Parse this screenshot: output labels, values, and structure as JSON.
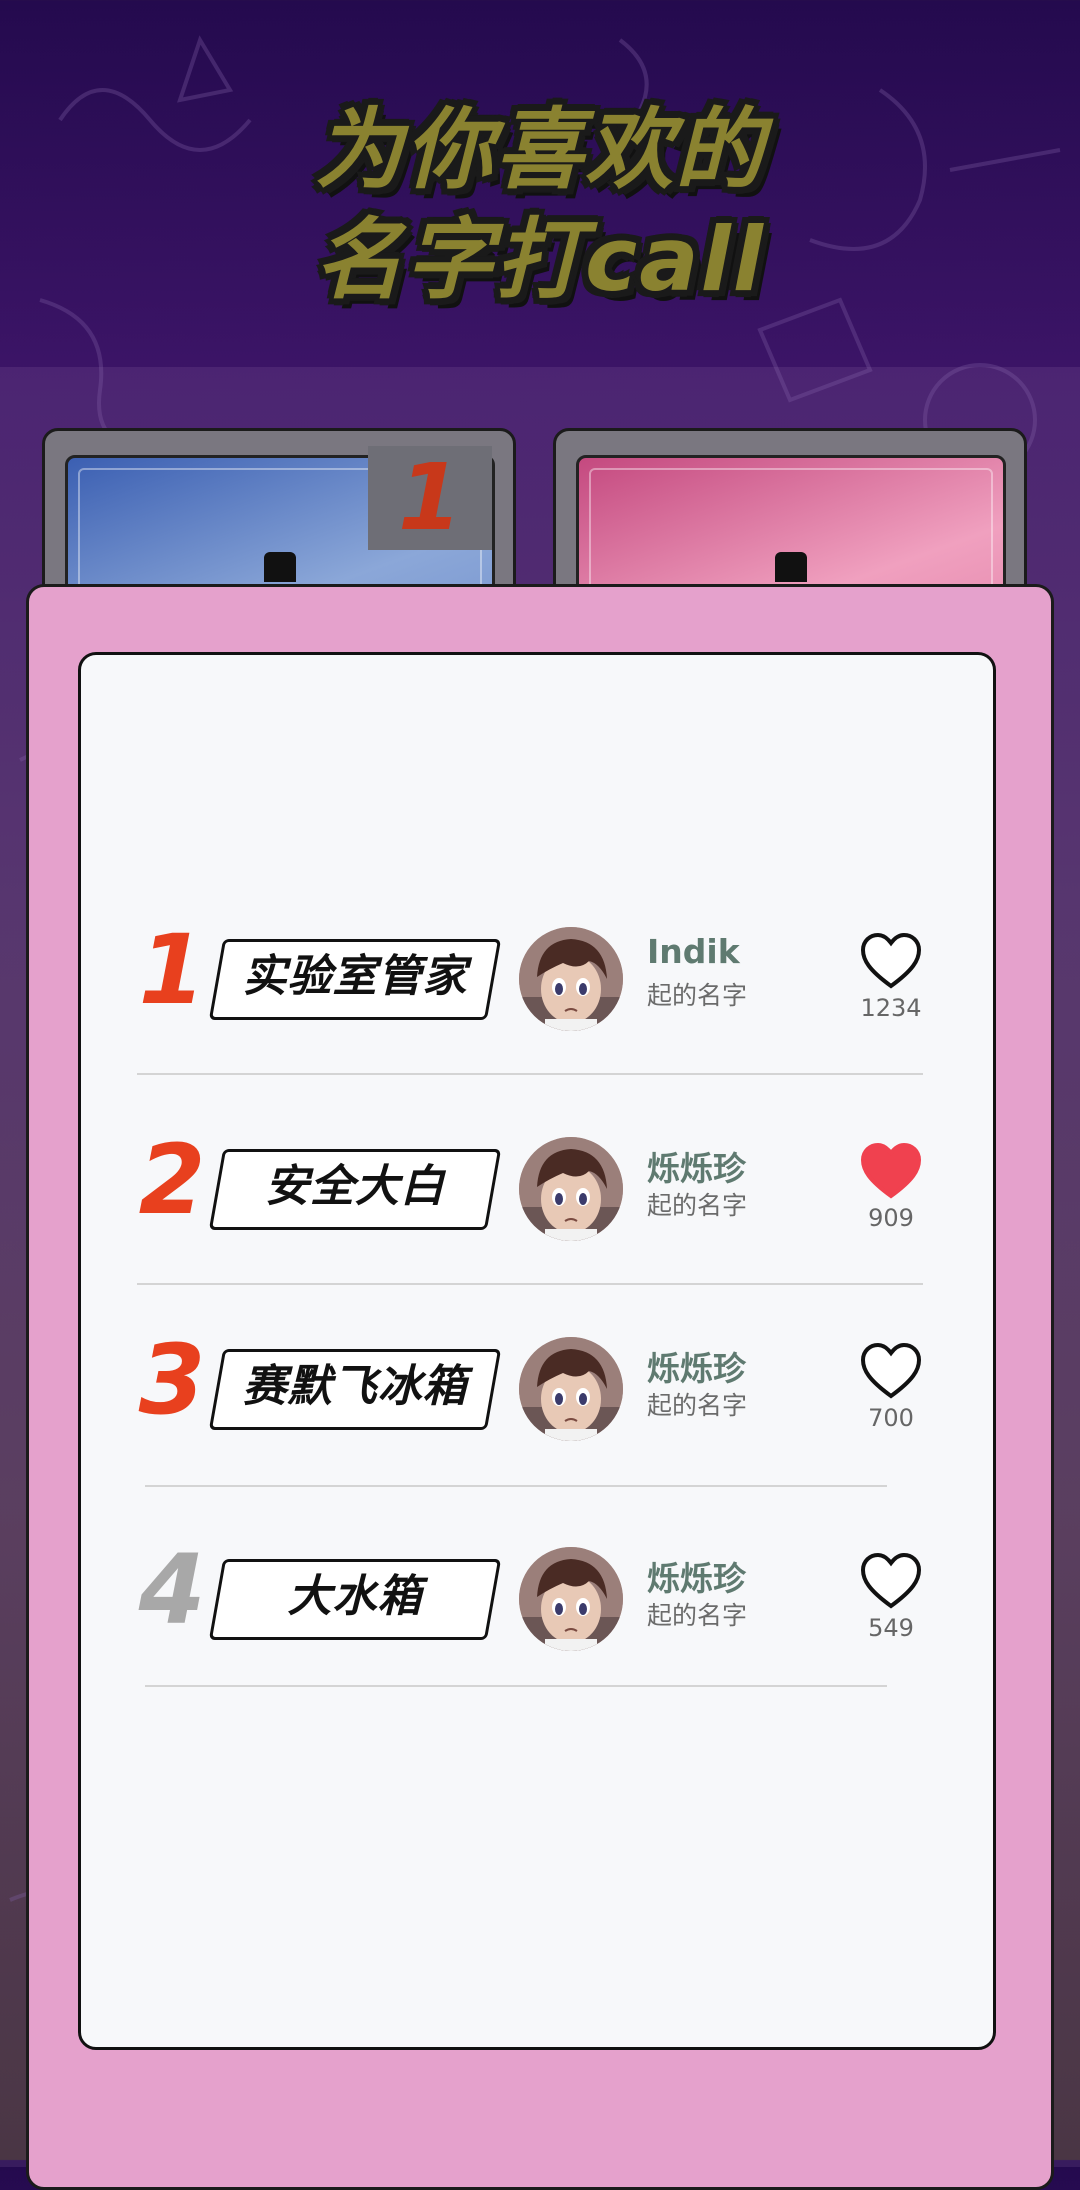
{
  "header": {
    "title_line1": "为你喜欢的",
    "title_line2": "名字打call"
  },
  "machine": {
    "badge": "1"
  },
  "colors": {
    "accent_rank": "#e8401e",
    "rank_inactive": "#a8a8a8",
    "liked_heart": "#f0414f",
    "panel": "#e5a1cc",
    "title_fill": "#8a8230"
  },
  "ranking": [
    {
      "rank": "1",
      "name": "实验室管家",
      "author": "Indik",
      "subtitle": "起的名字",
      "votes": "1234",
      "liked": false,
      "highlight": true
    },
    {
      "rank": "2",
      "name": "安全大白",
      "author": "烁烁珍",
      "subtitle": "起的名字",
      "votes": "909",
      "liked": true,
      "highlight": true
    },
    {
      "rank": "3",
      "name": "赛默飞冰箱",
      "author": "烁烁珍",
      "subtitle": "起的名字",
      "votes": "700",
      "liked": false,
      "highlight": true
    },
    {
      "rank": "4",
      "name": "大水箱",
      "author": "烁烁珍",
      "subtitle": "起的名字",
      "votes": "549",
      "liked": false,
      "highlight": false
    }
  ]
}
